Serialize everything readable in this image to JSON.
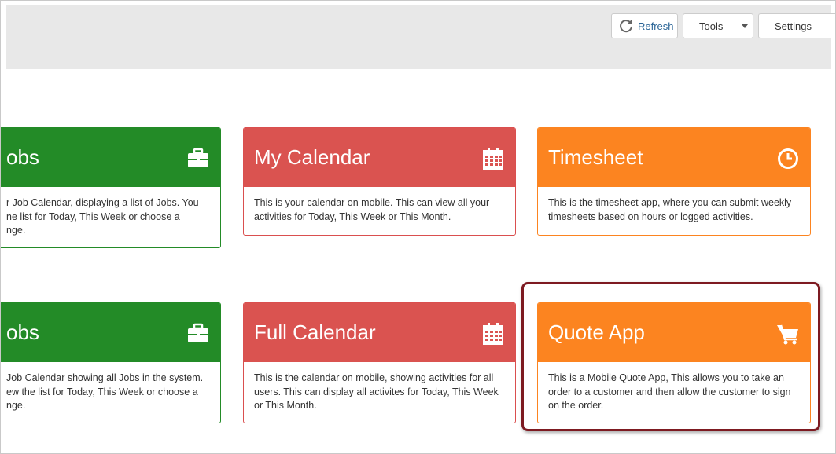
{
  "toolbar": {
    "refresh_label": "Refresh",
    "tools_label": "Tools",
    "settings_label": "Settings"
  },
  "tiles": [
    {
      "title": "obs",
      "icon": "briefcase-icon",
      "color": "#238b27",
      "desc": "r Job Calendar, displaying a list of Jobs. You\nne list for Today, This Week or choose a\nnge."
    },
    {
      "title": "My Calendar",
      "icon": "calendar-icon",
      "color": "#da5350",
      "desc": "This is your calendar on mobile. This can view all your activities for Today, This Week or This Month."
    },
    {
      "title": "Timesheet",
      "icon": "clock-icon",
      "color": "#fc8420",
      "desc": "This is the timesheet app, where you can submit weekly timesheets based on hours or logged activities."
    },
    {
      "title": "obs",
      "icon": "briefcase-icon",
      "color": "#238b27",
      "desc": " Job Calendar showing all Jobs in the system.\new the list for Today, This Week or choose a\nnge."
    },
    {
      "title": "Full Calendar",
      "icon": "calendar-icon",
      "color": "#da5350",
      "desc": "This is the calendar on mobile, showing activities for all users. This can display all activites for Today, This Week or This Month."
    },
    {
      "title": "Quote App",
      "icon": "cart-icon",
      "color": "#fc8420",
      "desc": "This is a Mobile Quote App, This allows you to take an order to a customer and then allow the customer to sign on the order."
    }
  ]
}
